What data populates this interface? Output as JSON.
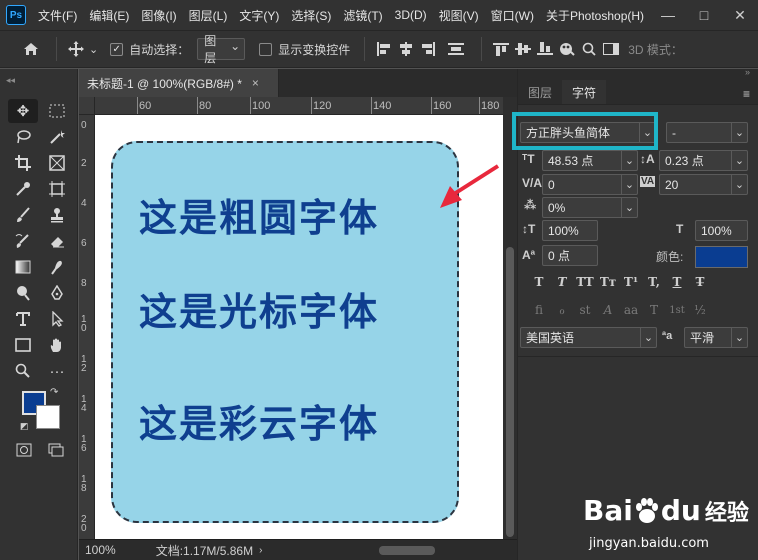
{
  "app": {
    "logo": "Ps",
    "menu": [
      "文件(F)",
      "编辑(E)",
      "图像(I)",
      "图层(L)",
      "文字(Y)",
      "选择(S)",
      "滤镜(T)",
      "3D(D)",
      "视图(V)",
      "窗口(W)",
      "关于Photoshop(H)"
    ],
    "window_controls": [
      "—",
      "□",
      "✕"
    ]
  },
  "options": {
    "auto_select_label": "自动选择：",
    "auto_select_checked": true,
    "layer_dropdown": "图层",
    "show_transform_label": "显示变换控件",
    "show_transform_checked": false,
    "mode_3d": "3D 模式："
  },
  "document": {
    "tab_title": "未标题-1 @ 100%(RGB/8#) *",
    "tab_close": "×",
    "ruler_h": [
      "60",
      "80",
      "100",
      "120",
      "140",
      "160",
      "180"
    ],
    "ruler_v": [
      "0",
      "2",
      "4",
      "6",
      "8",
      "10",
      "12",
      "14",
      "16",
      "18",
      "20"
    ],
    "canvas_texts": [
      "这是粗圆字体",
      "这是光标字体",
      "这是彩云字体"
    ],
    "zoom": "100%",
    "doc_info": "文档:1.17M/5.86M"
  },
  "panel": {
    "tabs": [
      "图层",
      "字符"
    ],
    "active_tab": "字符",
    "font_family": "方正胖头鱼简体",
    "font_style": "-",
    "font_size": "48.53 点",
    "leading": "0.23 点",
    "kerning": "0",
    "tracking": "20",
    "tsume": "0%",
    "vertical_scale": "100%",
    "horizontal_scale": "100%",
    "baseline_shift": "0 点",
    "color_label": "颜色:",
    "text_color": "#0a3d91",
    "typo_buttons_1": [
      "T",
      "T",
      "TT",
      "Tт",
      "T¹",
      "T,",
      "T",
      "T̶"
    ],
    "typo_buttons_2": [
      "fi",
      "ℴ",
      "st",
      "A",
      "aa",
      "T",
      "1st",
      "½"
    ],
    "language": "美国英语",
    "antialias_icon": "ªa",
    "antialias": "平滑"
  },
  "colors": {
    "foreground": "#0a3d91",
    "background": "#ffffff",
    "shape_fill": "#96d4e8",
    "text": "#0f3f8f",
    "arrow": "#e8283c",
    "highlight": "#1fb5c8"
  },
  "watermark": {
    "brand": "Bai",
    "brand_suffix": "du",
    "cn": "经验",
    "url": "jingyan.baidu.com"
  }
}
